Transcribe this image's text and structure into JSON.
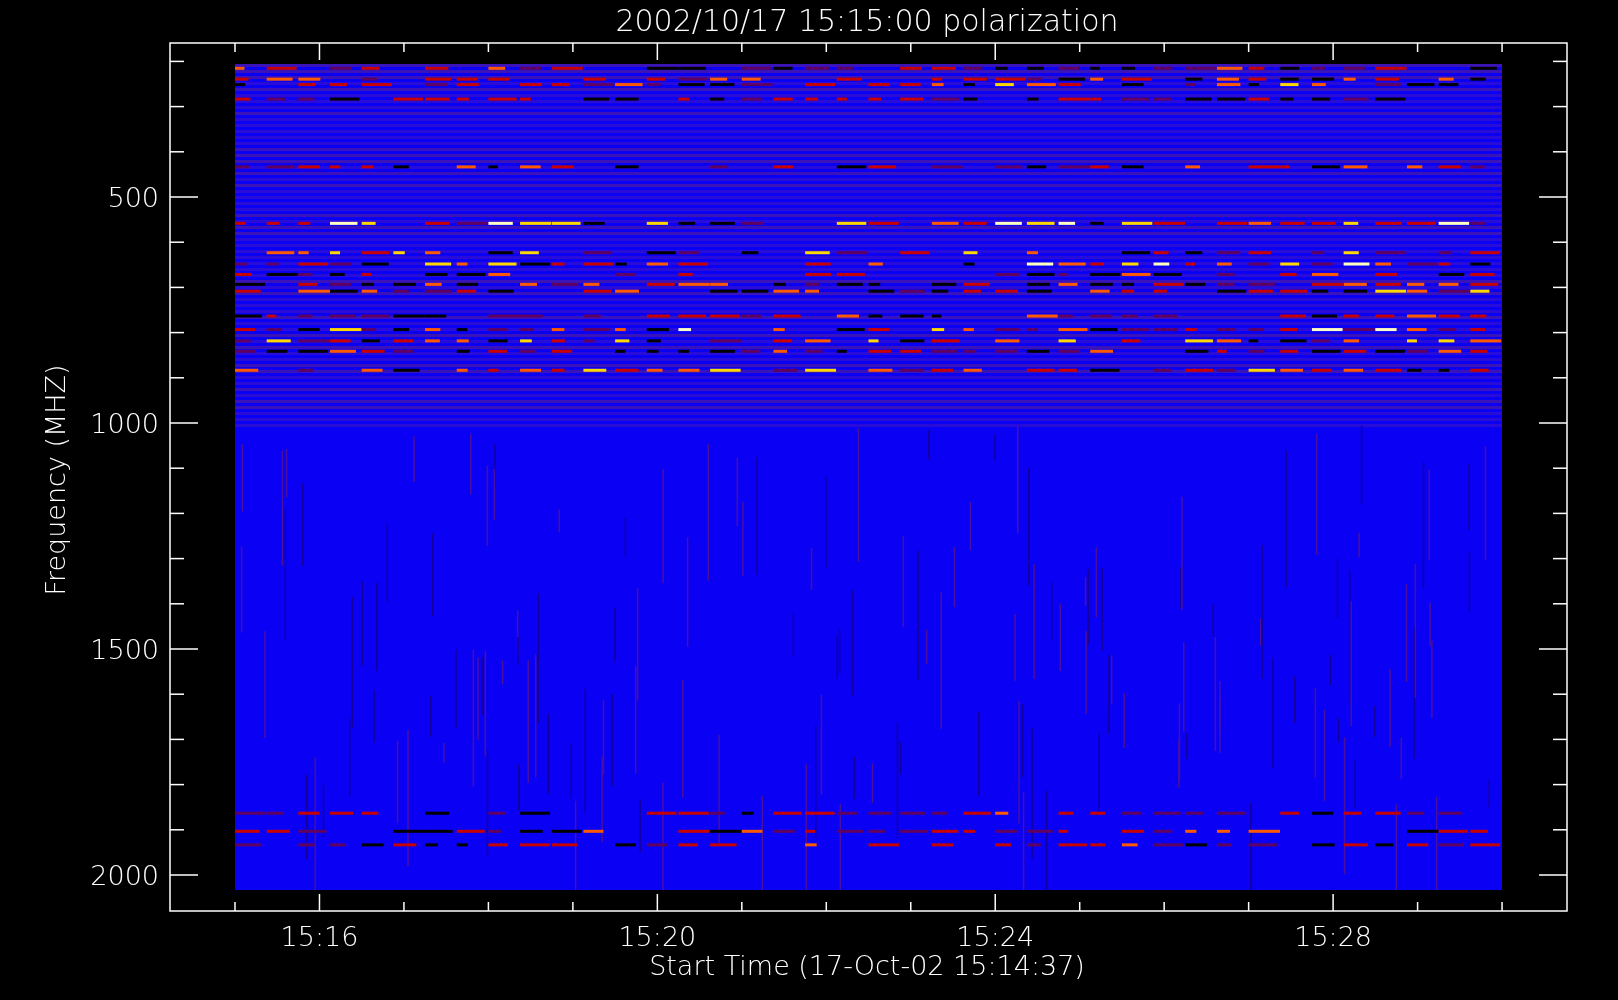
{
  "title": "2002/10/17 15:15:00 polarization",
  "y_axis": {
    "label": "Frequency (MHZ)",
    "ticks": [
      "500",
      "1000",
      "1500",
      "2000"
    ]
  },
  "x_axis": {
    "label": "Start Time (17-Oct-02 15:14:37)",
    "ticks": [
      "15:16",
      "15:20",
      "15:24",
      "15:28"
    ]
  }
}
